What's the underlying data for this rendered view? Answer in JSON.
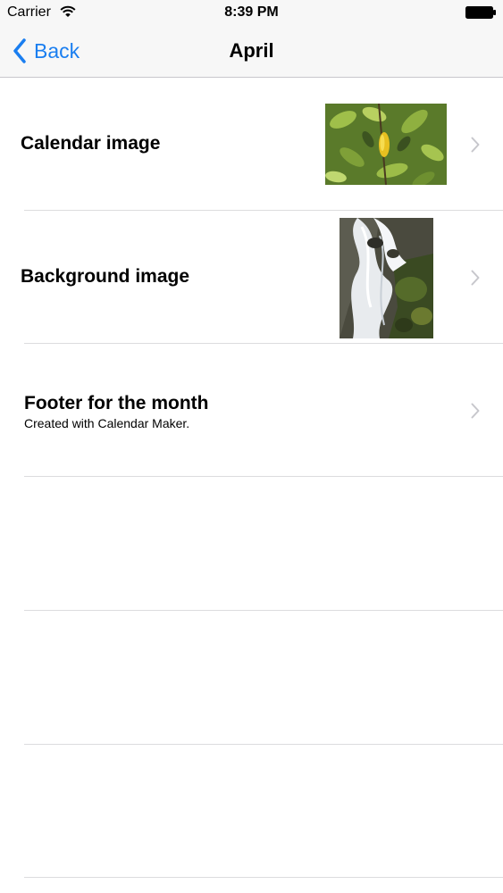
{
  "status_bar": {
    "carrier": "Carrier",
    "time": "8:39 PM"
  },
  "nav": {
    "back_label": "Back",
    "title": "April",
    "accent_color": "#1a7ef0"
  },
  "rows": [
    {
      "title": "Calendar image",
      "thumbnail": "leaves-photo"
    },
    {
      "title": "Background image",
      "thumbnail": "waterfall-photo"
    },
    {
      "title": "Footer for the month",
      "subtitle": "Created with Calendar Maker."
    }
  ],
  "empty_rows": 3
}
